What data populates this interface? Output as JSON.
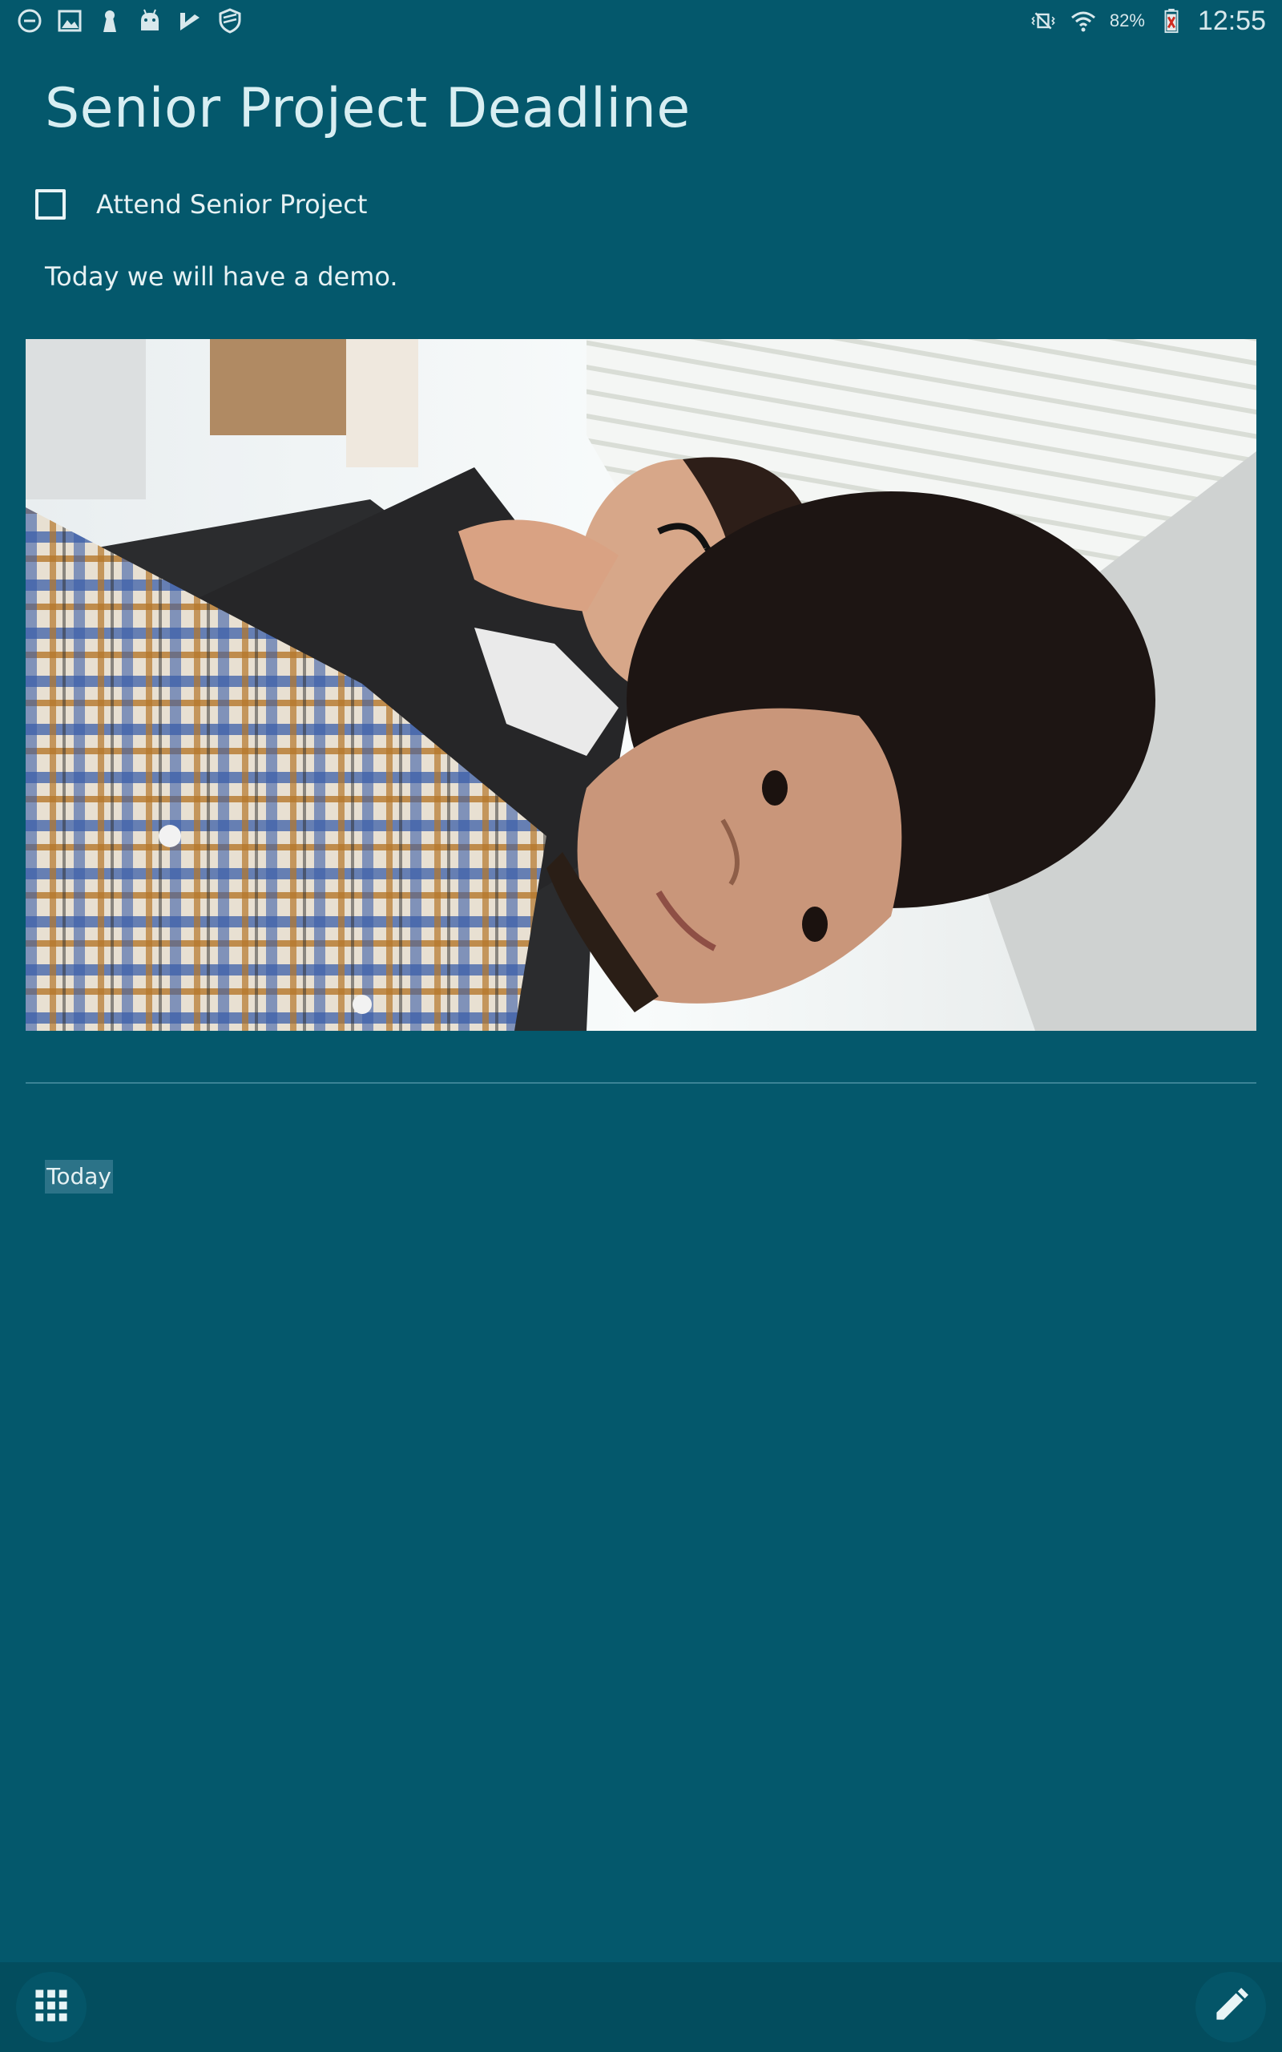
{
  "status_bar": {
    "left_icons": [
      "dnd-icon",
      "gallery-icon",
      "keyhole-icon",
      "android-icon",
      "feedly-icon",
      "shield-icon"
    ],
    "right_icons": [
      "vibrate-icon",
      "wifi-icon",
      "battery-icon"
    ],
    "battery_percent": "82%",
    "time": "12:55"
  },
  "note": {
    "title": "Senior Project Deadline",
    "checklist": [
      {
        "label": "Attend Senior Project",
        "checked": false
      }
    ],
    "body": "Today we will have a demo.",
    "date_label": "Today"
  },
  "colors": {
    "background": "#04586c",
    "bottom_bar": "#034d5e",
    "text": "#e6f1f3"
  },
  "bottom_bar": {
    "left_icon": "grid-icon",
    "right_icon": "edit-pencil-icon"
  }
}
